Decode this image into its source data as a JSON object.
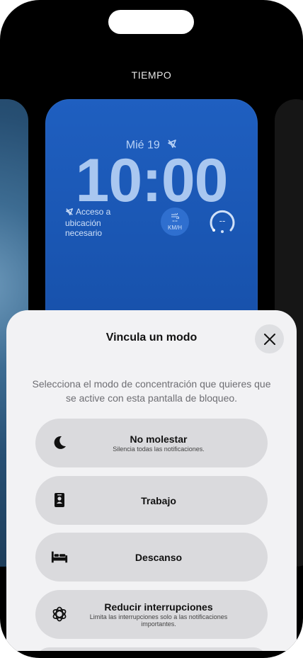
{
  "header": {
    "title": "TIEMPO"
  },
  "lockscreen": {
    "date": "Mié 19",
    "time": "10:00",
    "location_text": "Acceso a ubicación necesario",
    "wind_value": "--",
    "wind_unit": "KM/H",
    "gauge_value": "--"
  },
  "sheet": {
    "title": "Vincula un modo",
    "description": "Selecciona el modo de concentración que quieres que se active con esta pantalla de bloqueo.",
    "modes": [
      {
        "label": "No molestar",
        "subtitle": "Silencia todas las notificaciones.",
        "icon": "moon-icon"
      },
      {
        "label": "Trabajo",
        "subtitle": "",
        "icon": "id-badge-icon"
      },
      {
        "label": "Descanso",
        "subtitle": "",
        "icon": "bed-icon"
      },
      {
        "label": "Reducir interrupciones",
        "subtitle": "Limita las interrupciones solo a las notificaciones importantes.",
        "icon": "flower-icon"
      }
    ]
  },
  "colors": {
    "card_blue": "#1f5fc0",
    "sheet_bg": "#f2f2f4",
    "button_bg": "#dadadd"
  }
}
